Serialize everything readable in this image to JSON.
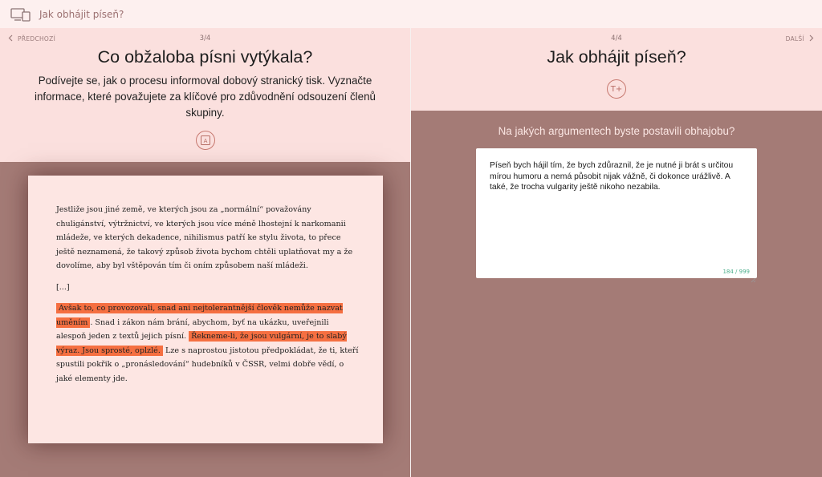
{
  "header": {
    "title": "Jak obhájit píseň?",
    "icon": "devices-icon"
  },
  "left": {
    "nav_prev": "PŘEDCHOZÍ",
    "counter": "3/4",
    "title": "Co obžaloba písni vytýkala?",
    "description": "Podívejte se, jak o procesu informoval dobový stranický tisk. Vyznačte informace, které považujete za klíčové pro zdůvodnění odsouzení členů skupiny.",
    "icon": "highlighter-icon",
    "icon_glyph": "A",
    "document": {
      "p1": "Jestliže jsou jiné země, ve kterých jsou za „normální“ považovány chuligánství, výtržnictví, ve kterých jsou více méně lhostejní k narkomanii mládeže, ve kterých dekadence, nihilismus patří ke stylu života, to přece ještě neznamená, že takový způsob života bychom chtěli uplatňovat my a že dovolíme, aby byl vštěpován tím či oním způsobem naší mládeži.",
      "p2": "[...]",
      "hl1": "Avšak to, co provozovali, snad ani nejtolerantnější člověk nemůže nazvat uměním",
      "t1": ". Snad i zákon nám brání, abychom, byť na ukázku, uveřejnili alespoň jeden z textů jejich písní.",
      "hl2": "Řekneme-li, že jsou vulgární, je to slabý výraz. Jsou sprosté, oplzlé.",
      "t2": "Lze s naprostou jistotou předpokládat, že ti, kteří spustili pokřik o „pronásledování“ hudebníků v ČSSR, velmi dobře vědí, o jaké elementy jde."
    },
    "highlight_color": "#f56f41"
  },
  "right": {
    "nav_next": "DALŠÍ",
    "counter": "4/4",
    "title": "Jak obhájit píseň?",
    "icon": "text-add-icon",
    "icon_glyph": "T+",
    "question": "Na jakých argumentech byste postavili obhajobu?",
    "answer": "Píseň bych hájil tím, že bych zdůraznil, že je nutné ji brát s určitou mírou humoru a nemá působit nijak vážně, či dokonce urážlivě. A také, že trocha vulgarity ještě nikoho nezabila.",
    "char_count": "184 / 999"
  },
  "colors": {
    "accent": "#c77970",
    "panel_body": "#a47b76",
    "panel_head": "#fbe0de",
    "count": "#4fb08e"
  }
}
